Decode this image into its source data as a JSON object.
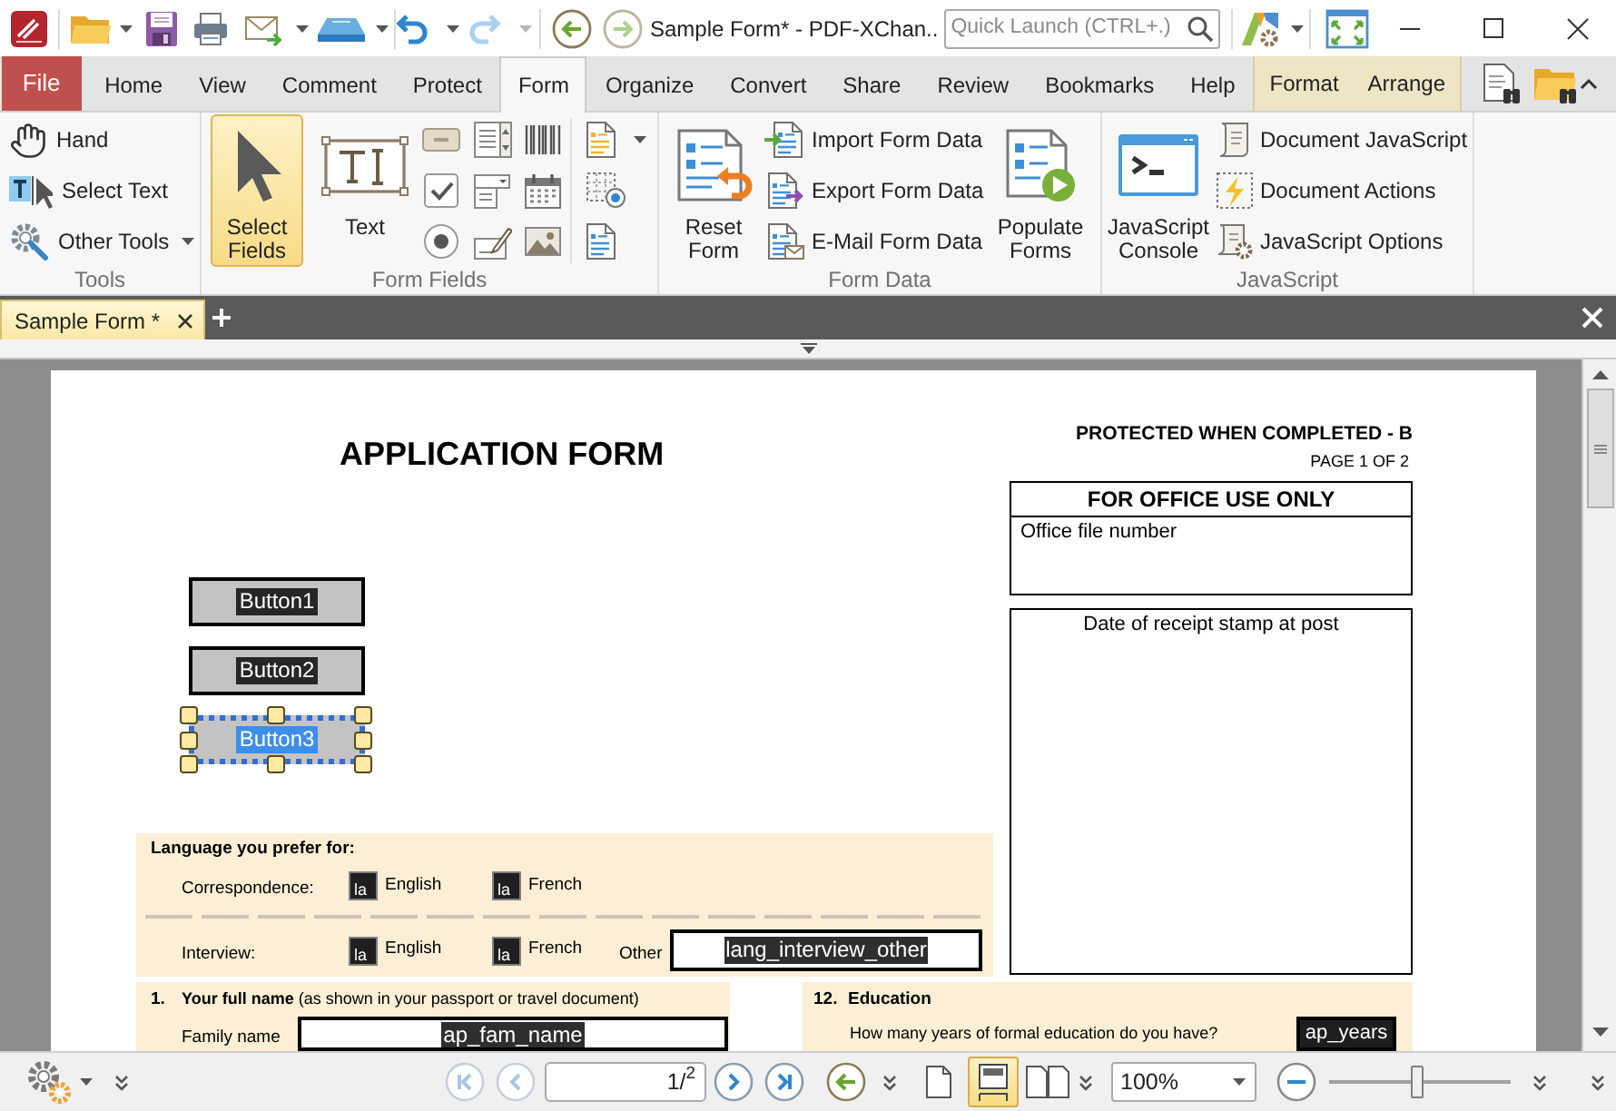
{
  "title_bar": {
    "edit": [
      {
        "kind": "undo",
        "disabled": false
      },
      {
        "kind": "redo",
        "disabled": true
      }
    ],
    "history": [
      {
        "kind": "back",
        "disabled": false
      },
      {
        "kind": "forward",
        "disabled": true
      }
    ],
    "title": "Sample Form* - PDF-XChan..",
    "quick_launch": {
      "placeholder": "Quick Launch (CTRL+.)"
    }
  },
  "menu_tabs": [
    {
      "label": "File",
      "kind": "file",
      "selected": false
    },
    {
      "label": "Home",
      "kind": "tab",
      "selected": false
    },
    {
      "label": "View",
      "kind": "tab",
      "selected": false
    },
    {
      "label": "Comment",
      "kind": "tab",
      "selected": false
    },
    {
      "label": "Protect",
      "kind": "tab",
      "selected": false
    },
    {
      "label": "Form",
      "kind": "tab",
      "selected": true
    },
    {
      "label": "Organize",
      "kind": "tab",
      "selected": false
    },
    {
      "label": "Convert",
      "kind": "tab",
      "selected": false
    },
    {
      "label": "Share",
      "kind": "tab",
      "selected": false
    },
    {
      "label": "Review",
      "kind": "tab",
      "selected": false
    },
    {
      "label": "Bookmarks",
      "kind": "tab",
      "selected": false
    },
    {
      "label": "Help",
      "kind": "tab",
      "selected": false
    },
    {
      "label": "Format",
      "kind": "contextual",
      "selected": false
    },
    {
      "label": "Arrange",
      "kind": "contextual",
      "selected": false
    }
  ],
  "ribbon": {
    "tools": {
      "label": "Tools",
      "items": [
        {
          "label": "Hand",
          "kind": "hand",
          "dropdown": false
        },
        {
          "label": "Select Text",
          "kind": "select_text",
          "dropdown": false
        },
        {
          "label": "Other Tools",
          "kind": "other_tools",
          "dropdown": true
        }
      ]
    },
    "form_fields": {
      "label": "Form Fields",
      "large_buttons": [
        {
          "label": "Select Fields",
          "kind": "select",
          "selected": true
        },
        {
          "label": "Text",
          "kind": "text",
          "selected": false
        }
      ]
    },
    "form_data": {
      "label": "Form Data",
      "reset": {
        "label": "Reset Form"
      },
      "items": [
        {
          "label": "Import Form Data",
          "kind": "import"
        },
        {
          "label": "Export Form Data",
          "kind": "export"
        },
        {
          "label": "E-Mail Form Data",
          "kind": "email"
        }
      ],
      "populate": {
        "label": "Populate Forms"
      }
    },
    "javascript": {
      "label": "JavaScript",
      "console": {
        "label": "JavaScript Console"
      },
      "items": [
        {
          "label": "Document JavaScript",
          "kind": "script"
        },
        {
          "label": "Document Actions",
          "kind": "actions"
        },
        {
          "label": "JavaScript Options",
          "kind": "options"
        }
      ]
    }
  },
  "document_tabs": [
    {
      "label": "Sample Form *",
      "selected": true
    }
  ],
  "page": {
    "title": "APPLICATION FORM",
    "classification": "PROTECTED WHEN COMPLETED - B",
    "page_number": "PAGE 1 OF 2",
    "office_box": {
      "heading": "FOR OFFICE USE ONLY",
      "label": "Office file number"
    },
    "stamp_box": {
      "label": "Date of receipt stamp at post"
    },
    "buttons": [
      {
        "label": "Button1",
        "selected": false
      },
      {
        "label": "Button2",
        "selected": false
      },
      {
        "label": "Button3",
        "selected": true
      }
    ],
    "language": {
      "heading": "Language you prefer for:",
      "rows": [
        {
          "label": "Correspondence:",
          "options": [
            {
              "field": "la",
              "label": "English"
            },
            {
              "field": "la",
              "label": "French"
            }
          ]
        },
        {
          "label": "Interview:",
          "options": [
            {
              "field": "la",
              "label": "English"
            },
            {
              "field": "la",
              "label": "French"
            }
          ],
          "other": {
            "label": "Other",
            "field": "lang_interview_other"
          }
        }
      ]
    },
    "full_name_section": {
      "number": "1.",
      "heading": "**Your full name** (as shown in your passport or travel document)",
      "rows": [
        {
          "label": "Family name",
          "field": "ap_fam_name"
        }
      ]
    },
    "education_section": {
      "number": "12.",
      "heading": "Education",
      "question": "How many years of formal education do you have?",
      "field": "ap_years"
    }
  },
  "status_bar": {
    "navigation": [
      {
        "kind": "first",
        "disabled": true
      },
      {
        "kind": "previous",
        "disabled": true
      },
      {
        "kind": "next",
        "disabled": false
      },
      {
        "kind": "last",
        "disabled": false
      }
    ],
    "page_field": {
      "value": "1/$^{2}$"
    },
    "view_modes": [
      {
        "kind": "single",
        "selected": false
      },
      {
        "kind": "continuous",
        "selected": true
      },
      {
        "kind": "facing",
        "selected": false
      }
    ],
    "zoom": {
      "value": "100%",
      "level": 0.48
    }
  }
}
